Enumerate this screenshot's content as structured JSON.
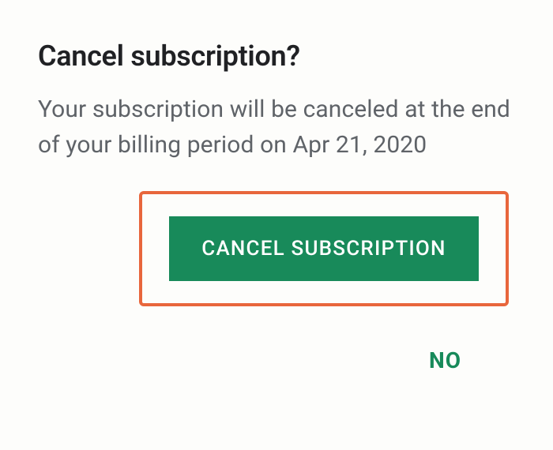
{
  "dialog": {
    "title": "Cancel subscription?",
    "message": "Your subscription will be canceled at the end of your billing period on Apr 21, 2020",
    "primary_button": "CANCEL SUBSCRIPTION",
    "secondary_button": "NO"
  }
}
